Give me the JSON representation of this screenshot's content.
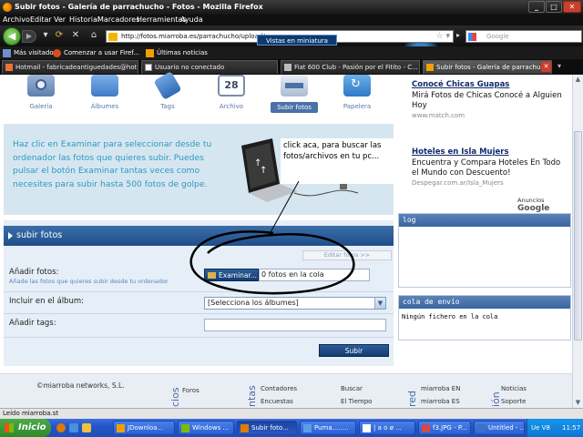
{
  "window": {
    "title": "Subir fotos - Galería de parrachucho - Fotos - Mozilla Firefox"
  },
  "menu": [
    "Archivo",
    "Editar",
    "Ver",
    "Historial",
    "Marcadores",
    "Herramientas",
    "Ayuda"
  ],
  "navbar": {
    "url": "http://fotos.miarroba.es/parrachucho/upload/",
    "tooltip": "Vistas en miniatura",
    "search_placeholder": "Google"
  },
  "bookmarks": [
    "Más visitados",
    "Comenzar a usar Firef...",
    "Últimas noticias"
  ],
  "tabs": [
    {
      "label": "Hotmail - fabricadeantiguedades@hot...",
      "active": false
    },
    {
      "label": "Usuario no conectado",
      "active": false
    },
    {
      "label": "Fiat 600 Club - Pasión por el Fitito - C...",
      "active": false
    },
    {
      "label": "Subir fotos - Galería de parrachu...",
      "active": true
    }
  ],
  "site_nav": [
    "Galería",
    "Álbumes",
    "Tags",
    "Archivo",
    "Subir fotos",
    "Papelera"
  ],
  "archive_day": "28",
  "hero": {
    "text": "Haz clic en Examinar para seleccionar desde tu ordenador las fotos que quieres subir. Puedes pulsar el botón Examinar tantas veces como necesites para subir hasta 500 fotos de golpe.",
    "annotation": "click aca, para buscar las fotos/archivos en tu pc..."
  },
  "form": {
    "header": "subir fotos",
    "edit_photos": "Editar fotos >>",
    "add_photos_label": "Añadir fotos:",
    "add_photos_hint": "Añade las fotos que quieres subir desde tu ordenador",
    "browse_button": "Examinar...",
    "queue_text": "0 fotos en la cola",
    "album_label": "Incluir en el álbum:",
    "album_value": "[Selecciona los álbumes]",
    "tags_label": "Añadir tags:",
    "tags_value": "",
    "submit": "Subir"
  },
  "ads": [
    {
      "title": "Conocé Chicas Guapas",
      "text": "Mirá Fotos de Chicas Conocé a Alguien Hoy",
      "url": "www.match.com"
    },
    {
      "title": "Hoteles en Isla Mujers",
      "text": "Encuentra y Compara Hoteles En Todo el Mundo con Descuento!",
      "url": "Despegar.com.ar/Isla_Mujers"
    }
  ],
  "ads_by": {
    "prefix": "Anuncios",
    "brand": "Google"
  },
  "log_panel": {
    "title": "log",
    "body": ""
  },
  "queue_panel": {
    "title": "cola de envío",
    "body": "Ningún fichero en la cola"
  },
  "footer": {
    "brand": "©miarroba networks, S.L.",
    "sections": [
      "Foros",
      "Contadores",
      "Encuestas",
      "Buscar",
      "El Tiempo",
      "miarroba EN",
      "miarroba ES",
      "Noticias",
      "Soporte"
    ],
    "vertical": [
      "cios",
      "ntas",
      "red",
      "ión"
    ]
  },
  "status": "Leído miarroba.st",
  "taskbar": {
    "start": "Inicio",
    "items": [
      {
        "label": "JDownloa...",
        "active": false
      },
      {
        "label": "Windows ...",
        "active": false
      },
      {
        "label": "Subir foto...",
        "active": true
      },
      {
        "label": "Puma........",
        "active": false
      },
      {
        "label": "| a o ø ...",
        "active": false
      },
      {
        "label": "f3.JPG - P...",
        "active": false
      },
      {
        "label": "Untitled - ...",
        "active": false
      }
    ],
    "lang": "Ue V8",
    "clock": "11:57"
  },
  "colors": {
    "accent": "#2c5d98",
    "hero_text": "#2c9ac0",
    "annotation_ring": "#000000"
  }
}
